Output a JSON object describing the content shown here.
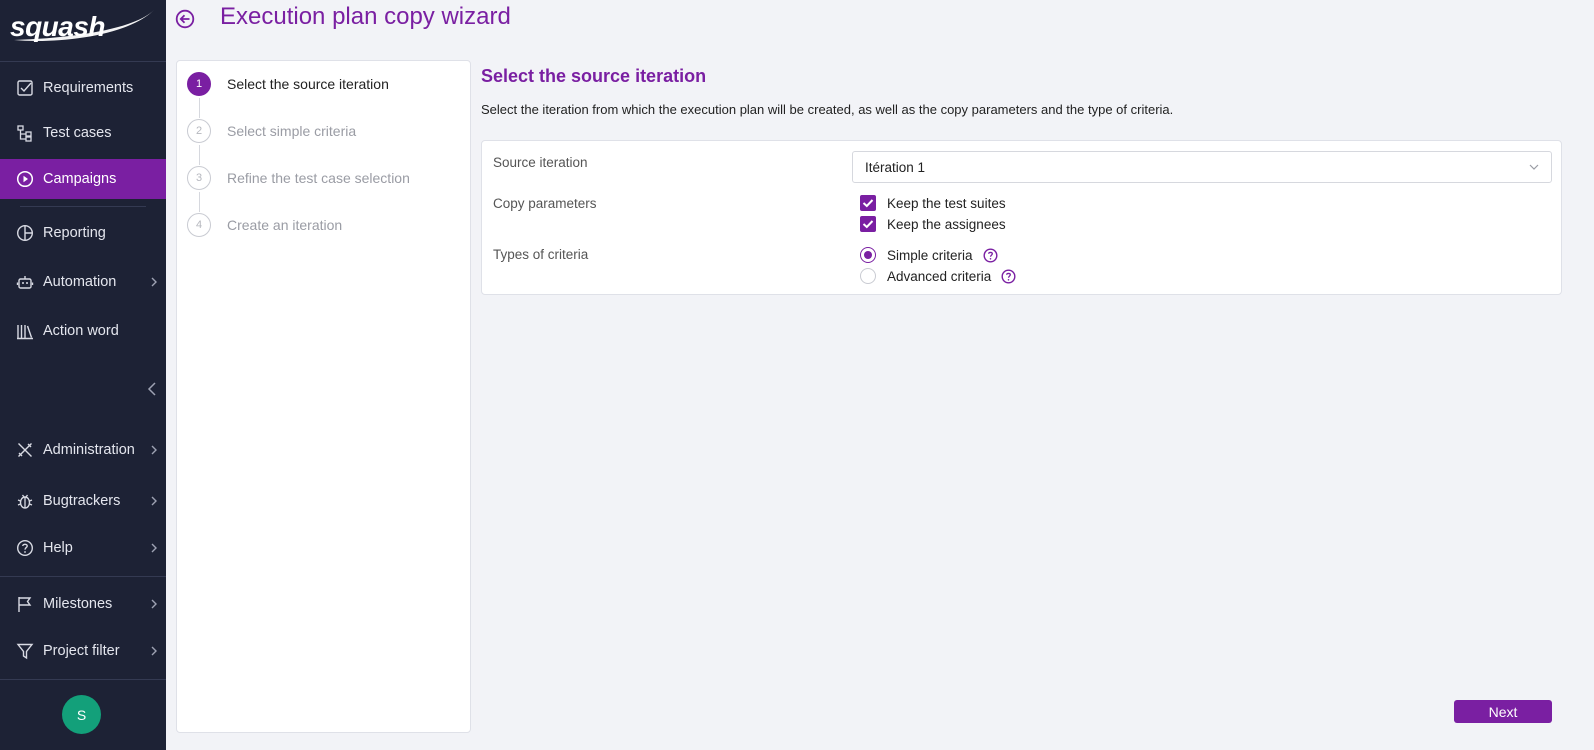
{
  "app": {
    "logo_text": "squash"
  },
  "sidebar": {
    "items": [
      {
        "label": "Requirements",
        "icon": "checkbox-icon"
      },
      {
        "label": "Test cases",
        "icon": "tree-icon"
      },
      {
        "label": "Campaigns",
        "icon": "play-circle-icon",
        "active": true
      },
      {
        "label": "Reporting",
        "icon": "pie-chart-icon"
      },
      {
        "label": "Automation",
        "icon": "robot-icon"
      },
      {
        "label": "Action word",
        "icon": "library-icon"
      },
      {
        "label": "Administration",
        "icon": "tools-icon"
      },
      {
        "label": "Bugtrackers",
        "icon": "bug-icon"
      },
      {
        "label": "Help",
        "icon": "question-circle-icon"
      },
      {
        "label": "Milestones",
        "icon": "flag-icon"
      },
      {
        "label": "Project filter",
        "icon": "filter-icon"
      }
    ],
    "user_initial": "S"
  },
  "header": {
    "title": "Execution plan copy wizard"
  },
  "steps": [
    {
      "number": "1",
      "label": "Select the source iteration",
      "current": true
    },
    {
      "number": "2",
      "label": "Select simple criteria"
    },
    {
      "number": "3",
      "label": "Refine the test case selection"
    },
    {
      "number": "4",
      "label": "Create an iteration"
    }
  ],
  "content": {
    "title": "Select the source iteration",
    "description": "Select the iteration from which the execution plan will be created, as well as the copy parameters and the type of criteria.",
    "source_label": "Source iteration",
    "source_value": "Itération 1",
    "copy_label": "Copy parameters",
    "copy_options": [
      {
        "label": "Keep the test suites",
        "checked": true
      },
      {
        "label": "Keep the assignees",
        "checked": true
      }
    ],
    "criteria_label": "Types of criteria",
    "criteria_options": [
      {
        "label": "Simple criteria",
        "selected": true
      },
      {
        "label": "Advanced criteria",
        "selected": false
      }
    ]
  },
  "footer": {
    "next_label": "Next"
  },
  "colors": {
    "accent": "#7a1fa2",
    "sidebar_bg": "#1d2235",
    "avatar_bg": "#13a07a"
  }
}
